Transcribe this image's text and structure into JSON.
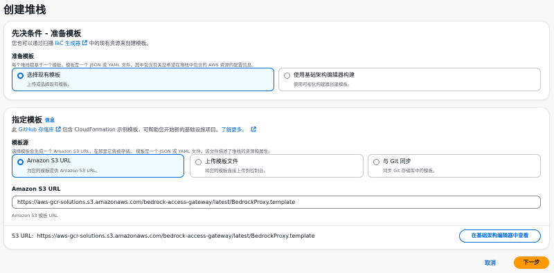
{
  "page": {
    "title": "创建堆栈"
  },
  "prereq": {
    "heading": "先决条件 - 准备模板",
    "desc_prefix": "您也可以通过扫描 ",
    "desc_link": "IaC 生成器",
    "desc_suffix": " 中的现有资源来创建模板。",
    "field_label": "准备模板",
    "field_desc": "每个堆栈都基于一个模板。模板是一个 JSON 或 YAML 文件，其中包含有关您希望在堆栈中包含的 AWS 资源的配置信息。",
    "options": [
      {
        "title": "选择现有模板",
        "sub": "上传或选择现有模板。",
        "selected": true
      },
      {
        "title": "使用基础架构编辑器构建",
        "sub": "使用可视化构建器创建模板。",
        "selected": false
      }
    ]
  },
  "template": {
    "heading": "指定模板",
    "info": "信息",
    "desc_prefix": "此 ",
    "desc_link": "GitHub 存储库",
    "desc_middle": " 包含 CloudFormation 示例模板，可帮助您开始新的基础设施项目。",
    "learn_more": "了解更多。",
    "source_label": "模板源",
    "source_desc": "选择模板会生成一个 Amazon S3 URL，在那里它将被存储。 模板是一个 JSON 或 YAML 文件，该文件描述了堆栈的资源和属性。",
    "options": [
      {
        "title": "Amazon S3 URL",
        "sub": "为您的模板提供 Amazon S3 URL。",
        "selected": true
      },
      {
        "title": "上传模板文件",
        "sub": "将您的模板直接上传到控制台。",
        "selected": false
      },
      {
        "title": "与 Git 同步",
        "sub": "同步 Git 存储库中的模板。",
        "selected": false
      }
    ],
    "url_label": "Amazon S3 URL",
    "url_value": "https://aws-gcr-solutions.s3.amazonaws.com/bedrock-access-gateway/latest/BedrockProxy.template",
    "url_hint": "Amazon S3 模板 URL",
    "s3_line_label": "S3 URL:",
    "s3_line_value": "https://aws-gcr-solutions.s3.amazonaws.com/bedrock-access-gateway/latest/BedrockProxy.template",
    "view_button": "在基础架构编辑器中查看"
  },
  "footer": {
    "cancel": "取消",
    "next": "下一步"
  },
  "colors": {
    "accent": "#006ce0",
    "primary_button": "#ff9900",
    "selected_tile_bg": "#f0fbff"
  },
  "icons": {
    "external": "external-link-icon",
    "radio": "radio-icon"
  }
}
